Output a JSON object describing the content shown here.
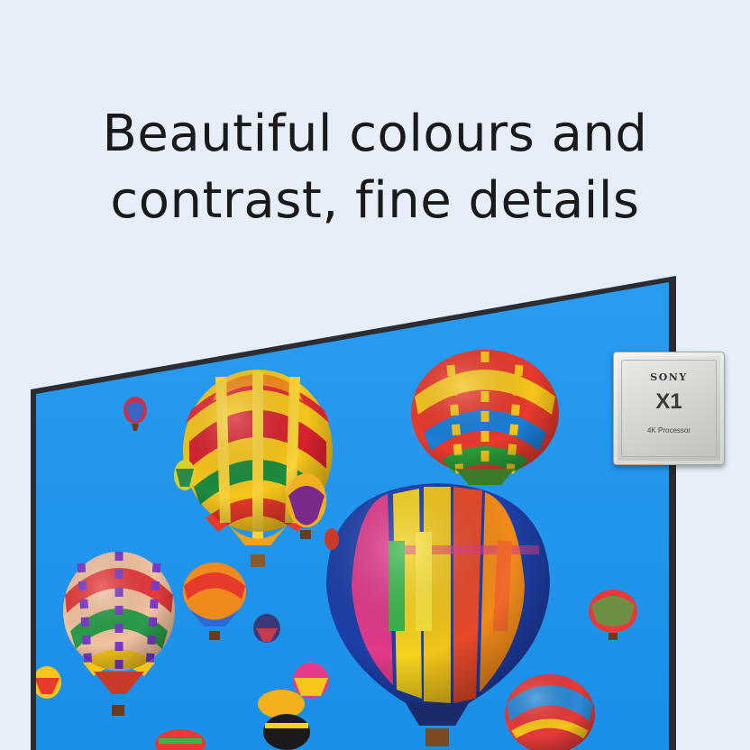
{
  "headline": {
    "line1": "Beautiful colours and",
    "line2": "contrast, fine details"
  },
  "chip": {
    "brand": "SONY",
    "model": "X1",
    "subtitle": "4K Processor"
  },
  "colors": {
    "background": "#e6eef9",
    "screen_sky": "#1e96ee",
    "tv_frame": "#2a2d33",
    "headline_text": "#1a1a1a"
  },
  "scene": {
    "description_icon": "hot-air-balloons-image"
  }
}
